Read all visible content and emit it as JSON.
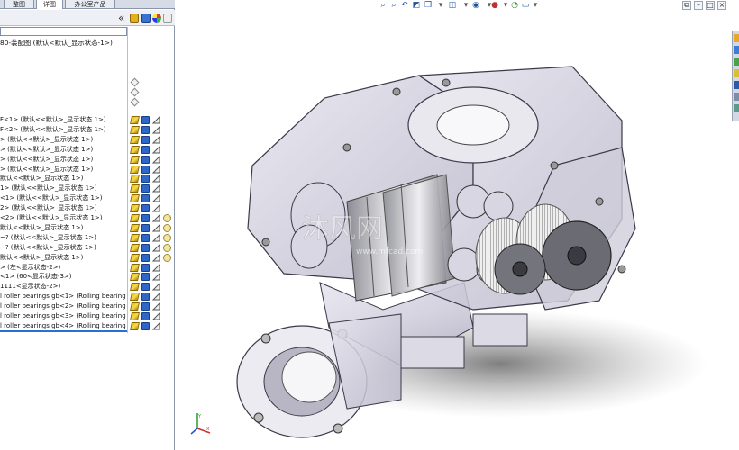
{
  "tree": {
    "tabs": [
      {
        "label": "整图"
      },
      {
        "label": "详图"
      },
      {
        "label": "办公室产品"
      }
    ],
    "collapse_glyph": "«",
    "assembly_title": "80-装配图 (默认<默认_显示状态-1>)",
    "rows": [
      {
        "text": "F<1> (默认<<默认>_显示状态 1>)"
      },
      {
        "text": "F<2> (默认<<默认>_显示状态 1>)"
      },
      {
        "text": "> (默认<<默认>_显示状态 1>)"
      },
      {
        "text": "> (默认<<默认>_显示状态 1>)"
      },
      {
        "text": "> (默认<<默认>_显示状态 1>)"
      },
      {
        "text": "> (默认<<默认>_显示状态 1>)"
      },
      {
        "text": "默认<<默认>_显示状态 1>)"
      },
      {
        "text": "1> (默认<<默认>_显示状态 1>)"
      },
      {
        "text": "<1> (默认<<默认>_显示状态 1>)"
      },
      {
        "text": "2> (默认<<默认>_显示状态 1>)"
      },
      {
        "text": "<2> (默认<<默认>_显示状态 1>)"
      },
      {
        "text": "默认<<默认>_显示状态 1>)"
      },
      {
        "text": "~? (默认<<默认>_显示状态 1>)"
      },
      {
        "text": "~? (默认<<默认>_显示状态 1>)"
      },
      {
        "text": "默认<<默认>_显示状态 1>)"
      },
      {
        "text": "> (左<显示状态-2>)"
      },
      {
        "text": "<1> (60<显示状态-3>)"
      },
      {
        "text": "1111<显示状态-2>)"
      },
      {
        "text": "l roller bearings gb<1> (Rolling bearing"
      },
      {
        "text": "l roller bearings gb<2> (Rolling bearing"
      },
      {
        "text": "l roller bearings gb<3> (Rolling bearing"
      },
      {
        "text": "l roller bearings gb<4> (Rolling bearing"
      }
    ],
    "row_icons": [
      "mate-icon",
      "component-icon",
      "display-state-icon"
    ]
  },
  "hud": {
    "icons": [
      "zoom-to-fit-icon",
      "zoom-area-icon",
      "previous-view-icon",
      "section-view-icon",
      "view-orientation-icon",
      "display-style-icon",
      "hide-show-icon",
      "edit-appearance-icon",
      "apply-scene-icon",
      "view-settings-icon"
    ]
  },
  "window": {
    "controls": [
      "restore",
      "minimize",
      "maximize",
      "close"
    ]
  },
  "watermark": {
    "text": "沐风网",
    "subtext": "www.mfcad.com"
  },
  "colors": {
    "accent": "#2a6fd6",
    "tree_bg": "#ffffff",
    "tab_bg": "#d6dbe6",
    "model_glass": "#c9c7d6",
    "model_edge": "#3a3a48"
  }
}
